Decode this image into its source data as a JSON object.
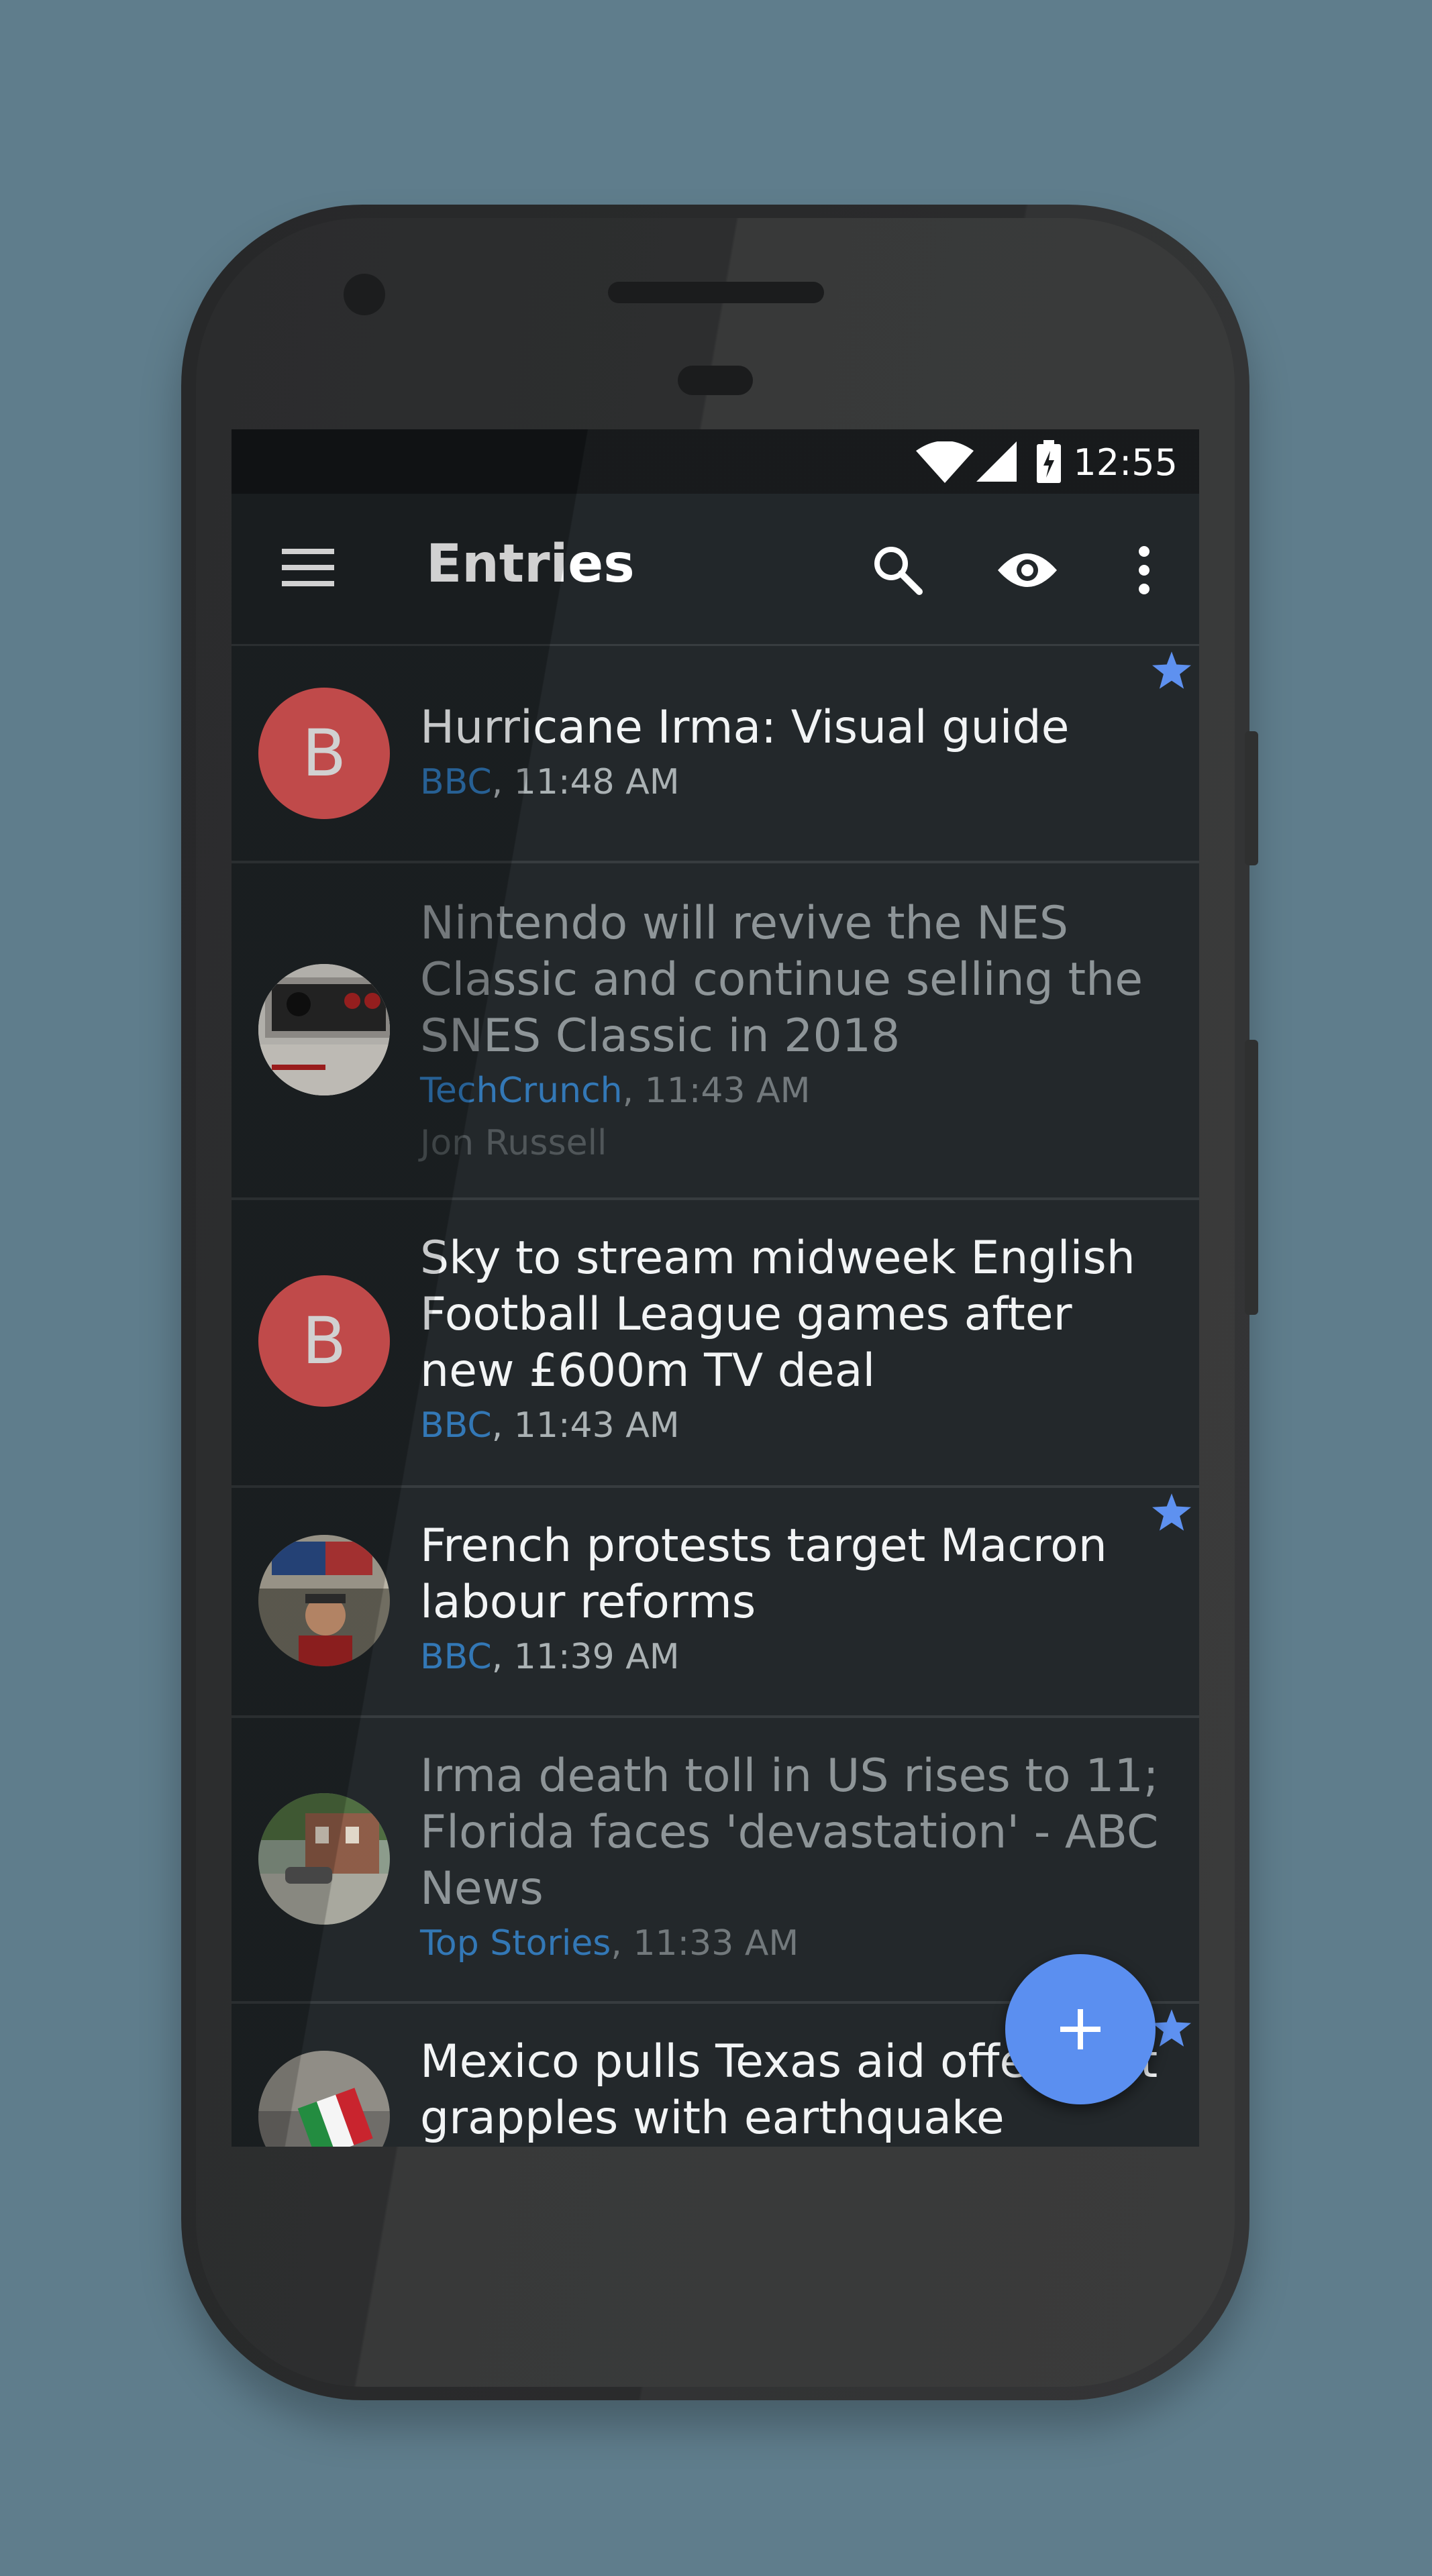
{
  "status_bar": {
    "time": "12:55"
  },
  "app_bar": {
    "title": "Entries",
    "icons": [
      "menu-icon",
      "search-icon",
      "eye-icon",
      "more-vert-icon"
    ]
  },
  "entries": [
    {
      "title": "Hurricane Irma: Visual guide",
      "source": "BBC",
      "time": ", 11:48 AM",
      "author": "",
      "avatar_letter": "B",
      "starred": true,
      "read": false
    },
    {
      "title": "Nintendo will revive the NES Classic and continue selling the SNES Classic in 2018",
      "source": "TechCrunch",
      "time": ", 11:43 AM",
      "author": "Jon Russell",
      "avatar_letter": "",
      "starred": false,
      "read": true
    },
    {
      "title": "Sky to stream midweek English Football League games after new £600m TV deal",
      "source": "BBC",
      "time": ", 11:43 AM",
      "author": "",
      "avatar_letter": "B",
      "starred": false,
      "read": false
    },
    {
      "title": "French protests target Macron labour reforms",
      "source": "BBC",
      "time": ", 11:39 AM",
      "author": "",
      "avatar_letter": "",
      "starred": true,
      "read": false
    },
    {
      "title": "Irma death toll in US rises to 11; Florida faces 'devastation' - ABC News",
      "source": "Top Stories",
      "time": ", 11:33 AM",
      "author": "",
      "avatar_letter": "",
      "starred": false,
      "read": true
    },
    {
      "title": "Mexico pulls Texas aid offer as it grapples with earthquake",
      "source": "",
      "time": "",
      "author": "",
      "avatar_letter": "",
      "starred": true,
      "read": false
    }
  ],
  "fab": {
    "icon": "plus-icon"
  },
  "colors": {
    "accent": "#5b8ff0",
    "avatar": "#ea5a5a",
    "source_link": "#2f75b5"
  }
}
